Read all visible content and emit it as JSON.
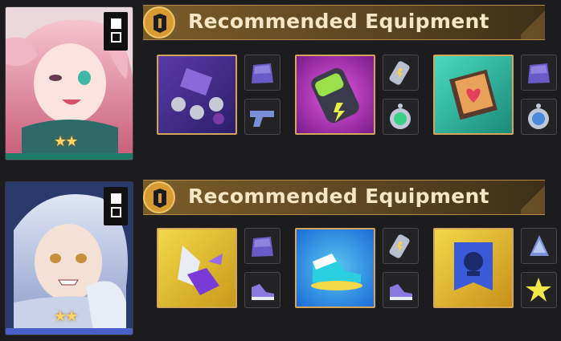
{
  "builds": [
    {
      "character": "pink-haired-character",
      "stars": "★★",
      "banner_title": "Recommended Equipment",
      "accent": "#1f7a6a"
    },
    {
      "character": "silver-haired-character",
      "stars": "★★",
      "banner_title": "Recommended Equipment",
      "accent": "#4a5fc8"
    }
  ]
}
